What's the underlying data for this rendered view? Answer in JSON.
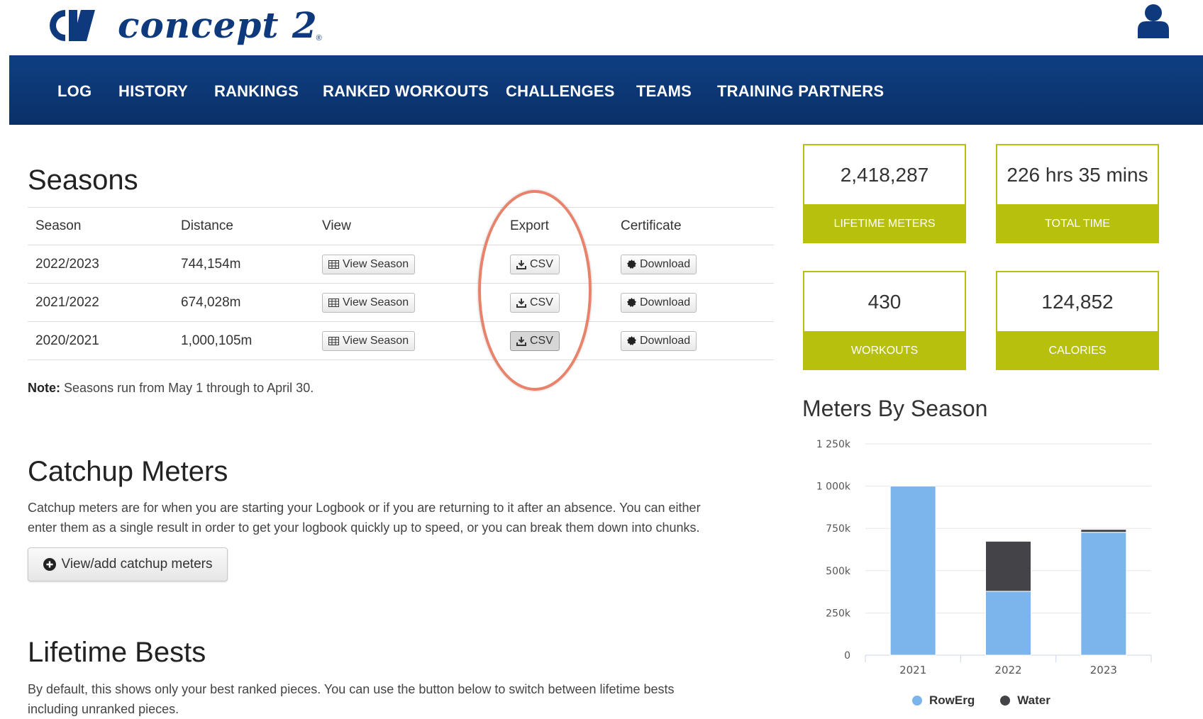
{
  "brand": {
    "name": "concept 2",
    "registered": "®"
  },
  "nav": [
    "LOG",
    "HISTORY",
    "RANKINGS",
    "RANKED WORKOUTS",
    "CHALLENGES",
    "TEAMS",
    "TRAINING PARTNERS"
  ],
  "seasons": {
    "title": "Seasons",
    "columns": [
      "Season",
      "Distance",
      "View",
      "Export",
      "Certificate"
    ],
    "rows": [
      {
        "season": "2022/2023",
        "distance": "744,154m",
        "view": "View Season",
        "export": "CSV",
        "certificate": "Download"
      },
      {
        "season": "2021/2022",
        "distance": "674,028m",
        "view": "View Season",
        "export": "CSV",
        "certificate": "Download"
      },
      {
        "season": "2020/2021",
        "distance": "1,000,105m",
        "view": "View Season",
        "export": "CSV",
        "certificate": "Download"
      }
    ],
    "note_label": "Note:",
    "note_text": "Seasons run from May 1 through to April 30."
  },
  "catchup": {
    "title": "Catchup Meters",
    "line1": "Catchup meters are for when you are starting your Logbook or if you are returning to it after an absence. You can either",
    "line2": "enter them as a single result in order to get your logbook quickly up to speed, or you can break them down into chunks.",
    "button": "View/add catchup meters"
  },
  "bests": {
    "title": "Lifetime Bests",
    "line1": "By default, this shows only your best ranked pieces. You can use the button below to switch between lifetime bests",
    "line2": "including unranked pieces."
  },
  "stats": [
    {
      "value": "2,418,287",
      "label": "LIFETIME METERS"
    },
    {
      "value": "226 hrs 35 mins",
      "label": "TOTAL TIME"
    },
    {
      "value": "430",
      "label": "WORKOUTS"
    },
    {
      "value": "124,852",
      "label": "CALORIES"
    }
  ],
  "colors": {
    "navy": "#0e3a7d",
    "accent": "#b7c00d",
    "rowerg": "#7cb5ec",
    "water": "#434348",
    "highlight": "#e8826a"
  },
  "icons": {
    "view": "table-icon",
    "export": "download-icon",
    "certificate": "certificate-badge-icon",
    "add": "plus-circle-icon",
    "user": "user-icon"
  },
  "chart_data": {
    "type": "bar",
    "stacked": true,
    "title": "Meters By Season",
    "categories": [
      "2021",
      "2022",
      "2023"
    ],
    "series": [
      {
        "name": "RowErg",
        "values": [
          1000105,
          378000,
          727000
        ]
      },
      {
        "name": "Water",
        "values": [
          0,
          296000,
          17000
        ]
      }
    ],
    "yticks": [
      "0",
      "250k",
      "500k",
      "750k",
      "1 000k",
      "1 250k"
    ],
    "ylim": [
      0,
      1250000
    ],
    "grid": true,
    "legend": "bottom"
  }
}
